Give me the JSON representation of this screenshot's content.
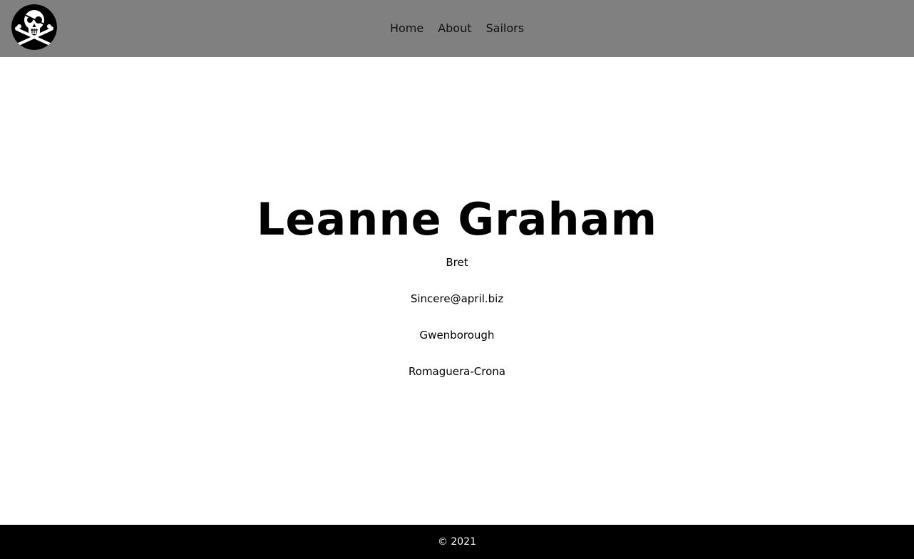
{
  "colors": {
    "navbar_bg": "#808080",
    "footer_bg": "#000000",
    "footer_text": "#ffffff",
    "page_bg": "#ffffff"
  },
  "header": {
    "logo_icon": "pirate-skull-crossbones-eyepatch-icon",
    "nav": [
      {
        "label": "Home"
      },
      {
        "label": "About"
      },
      {
        "label": "Sailors"
      }
    ]
  },
  "profile": {
    "name": "Leanne Graham",
    "username": "Bret",
    "email": "Sincere@april.biz",
    "city": "Gwenborough",
    "company": "Romaguera-Crona"
  },
  "footer": {
    "copyright": "© 2021"
  }
}
